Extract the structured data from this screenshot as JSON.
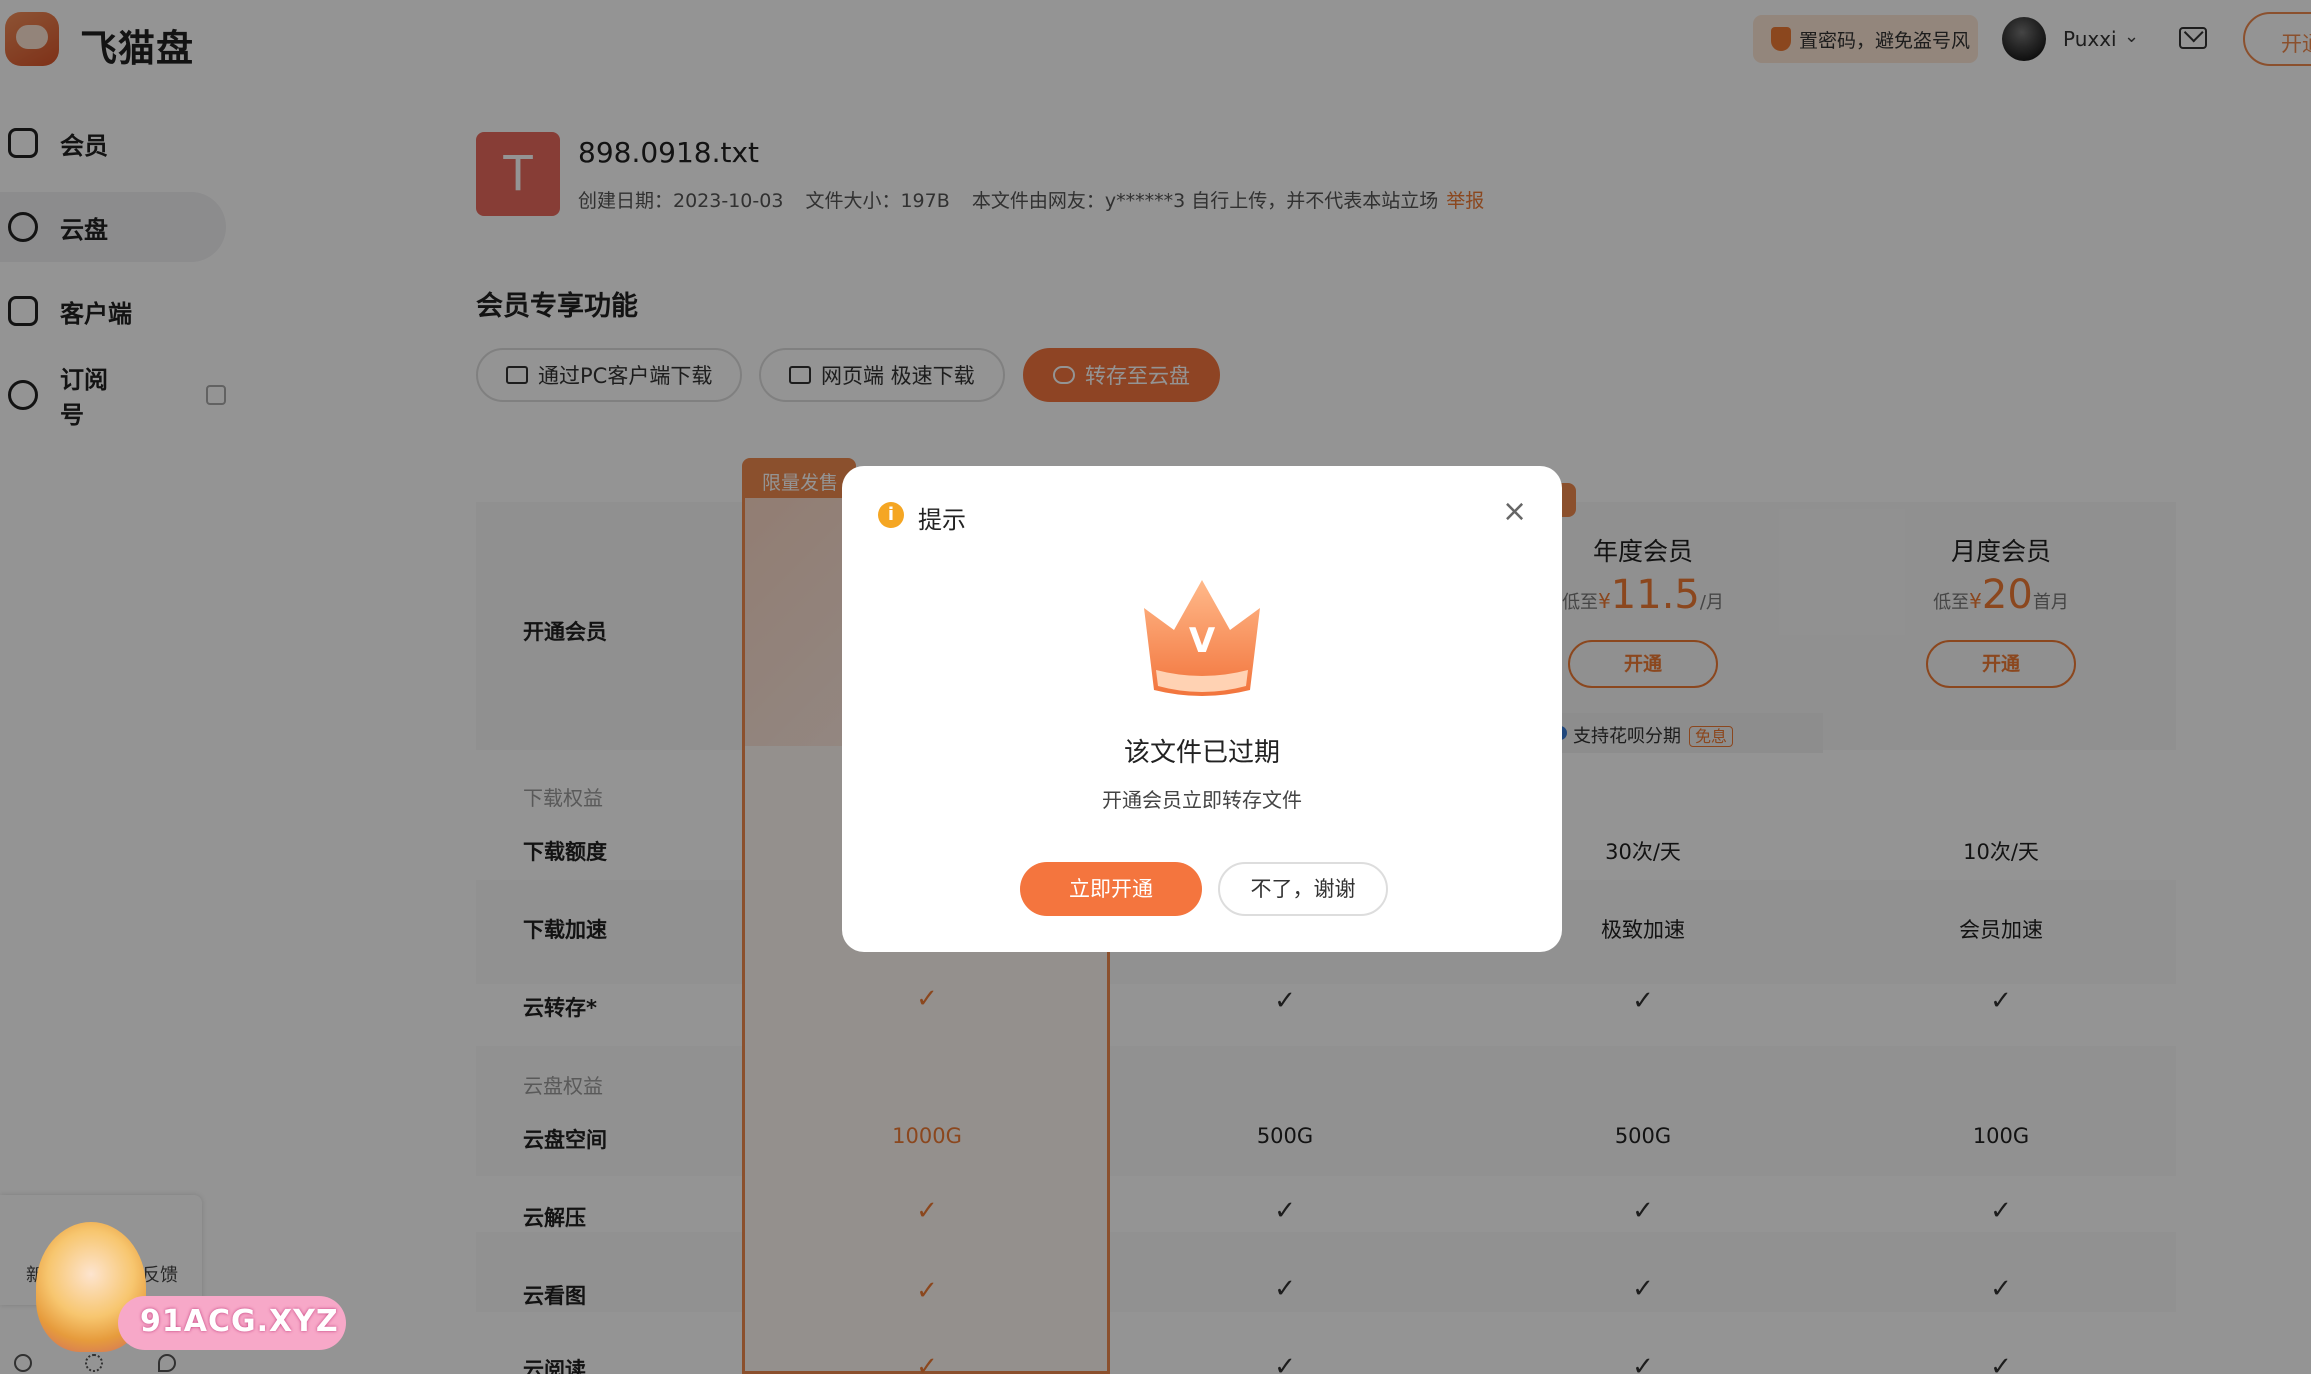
{
  "header": {
    "app_name": "飞猫盘",
    "security_tip": "置密码，避免盗号风",
    "username": "Puxxi",
    "open_button": "开通"
  },
  "sidebar": {
    "items": [
      {
        "label": "会员",
        "icon": "crown-icon"
      },
      {
        "label": "云盘",
        "icon": "cloud-icon"
      },
      {
        "label": "客户端",
        "icon": "client-icon"
      },
      {
        "label": "订阅号",
        "icon": "compass-icon"
      }
    ]
  },
  "file": {
    "icon_letter": "T",
    "name": "898.0918.txt",
    "created": "创建日期：2023-10-03",
    "size": "文件大小：197B",
    "uploader": "本文件由网友：y******3 自行上传，并不代表本站立场",
    "report": "举报"
  },
  "features": {
    "title": "会员专享功能",
    "buttons": [
      "通过PC客户端下载",
      "网页端 极速下载",
      "转存至云盘"
    ]
  },
  "plans": {
    "row_label_open": "开通会员",
    "highlight_tag": "限量发售",
    "annual": {
      "title": "年度会员",
      "price_prefix": "低至",
      "currency": "¥",
      "price": "11.5",
      "unit": "/月",
      "button": "开通"
    },
    "monthly": {
      "title": "月度会员",
      "price_prefix": "低至",
      "currency": "¥",
      "price": "20",
      "unit": "首月",
      "button": "开通"
    },
    "huabei": "支持花呗分期",
    "huabei_tag": "免息"
  },
  "table": {
    "group_download": "下载权益",
    "group_cloud": "云盘权益",
    "rows": {
      "quota": {
        "label": "下载额度",
        "annual": "30次/天",
        "monthly": "10次/天"
      },
      "speed": {
        "label": "下载加速",
        "annual": "极致加速",
        "monthly": "会员加速"
      },
      "transfer": {
        "label": "云转存*",
        "check": "✓"
      },
      "space": {
        "label": "云盘空间",
        "col1": "1000G",
        "col2": "500G",
        "col3": "500G",
        "col4": "100G"
      },
      "unzip": {
        "label": "云解压",
        "check": "✓"
      },
      "view": {
        "label": "云看图",
        "check": "✓"
      },
      "read": {
        "label": "云阅读",
        "check": "✓"
      }
    }
  },
  "feedback": {
    "left": "新版",
    "right": "反馈"
  },
  "watermark": "91ACG.XYZ",
  "modal": {
    "title": "提示",
    "close": "×",
    "heading": "该文件已过期",
    "subtext": "开通会员立即转存文件",
    "primary_button": "立即开通",
    "secondary_button": "不了，谢谢",
    "crown_letter": "V"
  },
  "colors": {
    "accent": "#f4753e",
    "overlay": "rgba(0,0,0,0.42)"
  }
}
